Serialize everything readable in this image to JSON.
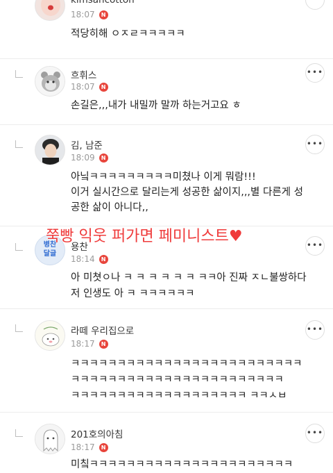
{
  "comments": [
    {
      "nickname": "kimsancotton",
      "time": "18:07",
      "badge": "N",
      "lines": [
        "적당히해 ㅇㅈㄹㅋㅋㅋㅋㅋ"
      ]
    },
    {
      "nickname": "흐휘스",
      "time": "18:07",
      "badge": "N",
      "lines": [
        "손길은,,,내가 내밀까 말까 하는거고요 ㅎ"
      ]
    },
    {
      "nickname": "김, 남준",
      "time": "18:09",
      "badge": "N",
      "lines": [
        "아닠ㅋㅋㅋㅋㅋㅋㅋㅋㅋ미쳤나 이게 뭐람!!!",
        "이거 실시간으로 달리는게 성공한 삶이지,,,별 다른게 성",
        "공한 삶이 아니다,,"
      ]
    },
    {
      "nickname": "용찬",
      "time": "18:14",
      "badge": "N",
      "avatar_text": [
        "병찬",
        "달글"
      ],
      "lines": [
        "아 미쳣ㅇ나 ㅋ ㅋ ㅋ ㅋ ㅋ ㅋ ㅋㅋ아 진짜 ㅈㄴ불쌍하다",
        "저 인생도 아 ㅋ ㅋㅋㅋㅋㅋㅋ"
      ]
    },
    {
      "nickname": "라떼 우리집으로",
      "time": "18:17",
      "badge": "N",
      "lines": [
        "ㅋㅋㅋㅋㅋㅋㅋㅋㅋㅋㅋㅋㅋㅋㅋㅋㅋㅋㅋㅋㅋㅋㅋㅋㅋ",
        "ㅋㅋㅋㅋㅋㅋㅋㅋㅋㅋㅋㅋㅋㅋㅋㅋㅋㅋㅋㅋㅋㅋㅋ",
        "ㅋㅋㅋㅋㅋㅋㅋㅋㅋㅋㅋㅋㅋㅋㅋㅋㅋㅋㅋ ㅋㅋㅅㅂ"
      ]
    },
    {
      "nickname": "201호의아침",
      "time": "18:17",
      "badge": "N",
      "lines": [
        "미칰ㅋㅋㅋㅋㅋㅋㅋㅋㅋㅋㅋㅋㅋㅋㅋㅋㅋㅋㅋㅋㅋㅋ"
      ]
    }
  ],
  "overlay_caption": "쭉빵 익웃 퍼가면 페미니스트♥",
  "more_button_label": "•••",
  "colors": {
    "badge": "#e8453c",
    "overlay": "#ef3b3b",
    "timestamp": "#9a9a9a"
  }
}
